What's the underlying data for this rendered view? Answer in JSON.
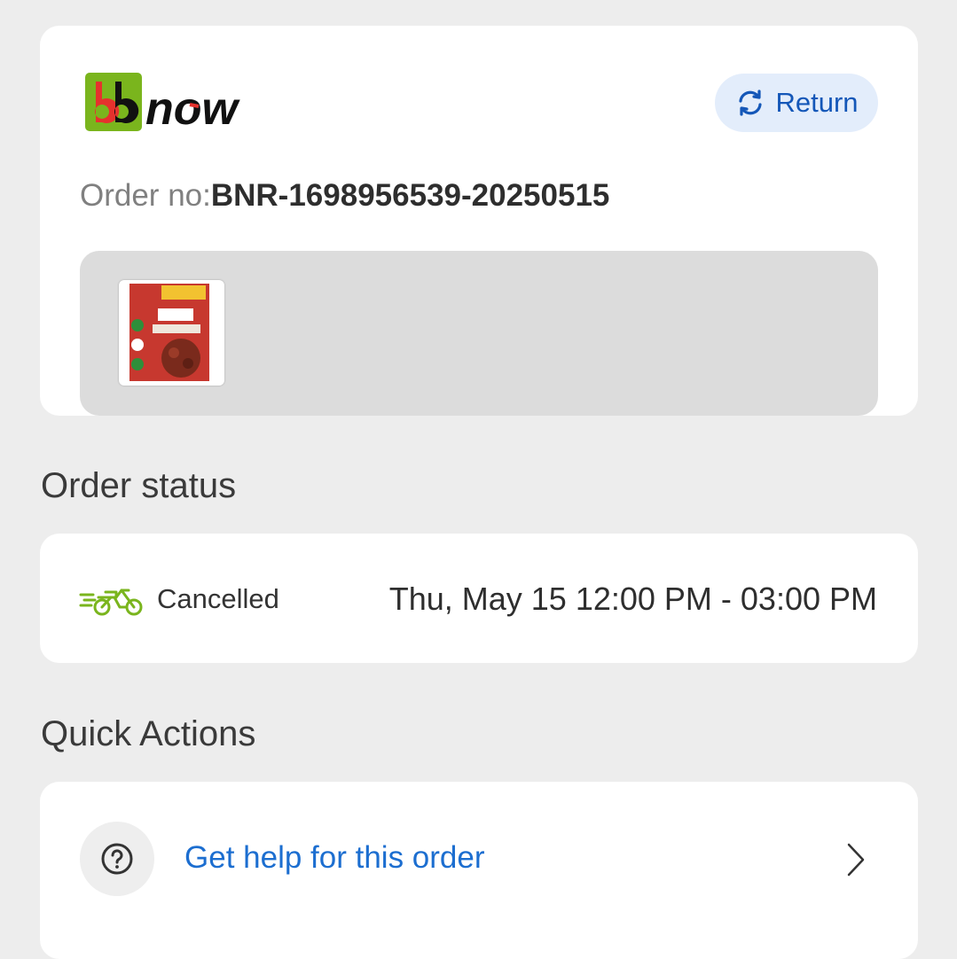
{
  "order_card": {
    "brand": "bbnow",
    "return_label": "Return",
    "order_no_label": "Order no:",
    "order_no_value": "BNR-1698956539-20250515",
    "item_thumbnail_icon": "product-pack-icon"
  },
  "order_status": {
    "section_title": "Order status",
    "status": "Cancelled",
    "time_slot": "Thu, May 15 12:00 PM - 03:00 PM",
    "delivery_icon": "delivery-bike-icon"
  },
  "quick_actions": {
    "section_title": "Quick Actions",
    "items": [
      {
        "label": "Get help for this order",
        "icon": "help-question-icon"
      }
    ]
  },
  "colors": {
    "page_bg": "#ededed",
    "card_bg": "#ffffff",
    "accent_blue": "#1c6ed0",
    "return_bg": "#e3edfb",
    "brand_green": "#7ab51d",
    "brand_red": "#e5322d"
  }
}
